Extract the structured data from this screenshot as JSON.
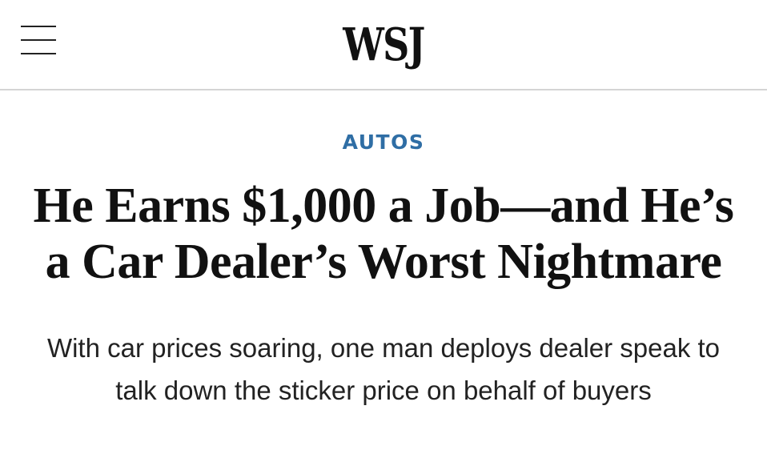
{
  "header": {
    "menu_icon": "hamburger-menu-icon",
    "logo_text": "WSJ"
  },
  "article": {
    "section": "AUTOS",
    "headline": "He Earns $1,000 a Job—and He’s a Car Dealer’s Worst Nightmare",
    "dek": "With car prices soaring, one man deploys dealer speak to talk down the sticker price on behalf of buyers"
  },
  "colors": {
    "section_accent": "#2f6ea5",
    "text": "#111111",
    "divider": "#d4d4d4"
  }
}
